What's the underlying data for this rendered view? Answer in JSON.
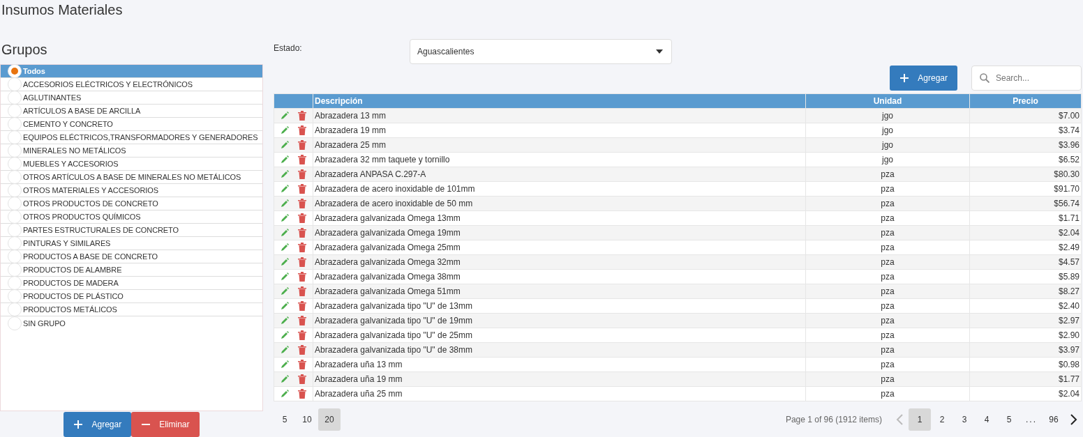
{
  "title": "Insumos Materiales",
  "groups": {
    "heading": "Grupos",
    "items": [
      {
        "label": "Todos",
        "selected": true
      },
      {
        "label": "ACCESORIOS ELÉCTRICOS Y ELECTRÓNICOS",
        "selected": false
      },
      {
        "label": "AGLUTINANTES",
        "selected": false
      },
      {
        "label": "ARTÍCULOS A BASE DE ARCILLA",
        "selected": false
      },
      {
        "label": "CEMENTO Y CONCRETO",
        "selected": false
      },
      {
        "label": "EQUIPOS ELÉCTRICOS,TRANSFORMADORES Y GENERADORES",
        "selected": false
      },
      {
        "label": "MINERALES NO METÁLICOS",
        "selected": false
      },
      {
        "label": "MUEBLES Y ACCESORIOS",
        "selected": false
      },
      {
        "label": "OTROS ARTÍCULOS A BASE DE MINERALES NO METÁLICOS",
        "selected": false
      },
      {
        "label": "OTROS MATERIALES Y ACCESORIOS",
        "selected": false
      },
      {
        "label": "OTROS PRODUCTOS DE CONCRETO",
        "selected": false
      },
      {
        "label": "OTROS PRODUCTOS QUÍMICOS",
        "selected": false
      },
      {
        "label": "PARTES ESTRUCTURALES DE CONCRETO",
        "selected": false
      },
      {
        "label": "PINTURAS Y SIMILARES",
        "selected": false
      },
      {
        "label": "PRODUCTOS A BASE DE CONCRETO",
        "selected": false
      },
      {
        "label": "PRODUCTOS DE ALAMBRE",
        "selected": false
      },
      {
        "label": "PRODUCTOS DE MADERA",
        "selected": false
      },
      {
        "label": "PRODUCTOS DE PLÁSTICO",
        "selected": false
      },
      {
        "label": "PRODUCTOS METÁLICOS",
        "selected": false
      },
      {
        "label": "SIN GRUPO",
        "selected": false
      }
    ],
    "buttons": [
      {
        "kind": "add",
        "label": "Agregar"
      },
      {
        "kind": "remove",
        "label": "Eliminar"
      }
    ]
  },
  "filter": {
    "label": "Estado:",
    "value": "Aguascalientes"
  },
  "toolbar": {
    "add_button": "Agregar",
    "search": {
      "placeholder": "Search..."
    }
  },
  "table": {
    "columns": [
      "Descripción",
      "Unidad",
      "Precio"
    ],
    "rows": [
      {
        "description": "Abrazadera 13 mm",
        "unit": "jgo",
        "price": "$7.00"
      },
      {
        "description": "Abrazadera 19 mm",
        "unit": "jgo",
        "price": "$3.74"
      },
      {
        "description": "Abrazadera 25 mm",
        "unit": "jgo",
        "price": "$3.96"
      },
      {
        "description": "Abrazadera 32 mm taquete y tornillo",
        "unit": "jgo",
        "price": "$6.52"
      },
      {
        "description": "Abrazadera ANPASA C.297-A",
        "unit": "pza",
        "price": "$80.30"
      },
      {
        "description": "Abrazadera de acero inoxidable de 101mm",
        "unit": "pza",
        "price": "$91.70"
      },
      {
        "description": "Abrazadera de acero inoxidable de 50 mm",
        "unit": "pza",
        "price": "$56.74"
      },
      {
        "description": "Abrazadera galvanizada Omega 13mm",
        "unit": "pza",
        "price": "$1.71"
      },
      {
        "description": "Abrazadera galvanizada Omega 19mm",
        "unit": "pza",
        "price": "$2.04"
      },
      {
        "description": "Abrazadera galvanizada Omega 25mm",
        "unit": "pza",
        "price": "$2.49"
      },
      {
        "description": "Abrazadera galvanizada Omega 32mm",
        "unit": "pza",
        "price": "$4.57"
      },
      {
        "description": "Abrazadera galvanizada Omega 38mm",
        "unit": "pza",
        "price": "$5.89"
      },
      {
        "description": "Abrazadera galvanizada Omega 51mm",
        "unit": "pza",
        "price": "$8.27"
      },
      {
        "description": "Abrazadera galvanizada tipo \"U\" de 13mm",
        "unit": "pza",
        "price": "$2.40"
      },
      {
        "description": "Abrazadera galvanizada tipo \"U\" de 19mm",
        "unit": "pza",
        "price": "$2.97"
      },
      {
        "description": "Abrazadera galvanizada tipo \"U\" de 25mm",
        "unit": "pza",
        "price": "$2.90"
      },
      {
        "description": "Abrazadera galvanizada tipo \"U\" de 38mm",
        "unit": "pza",
        "price": "$3.97"
      },
      {
        "description": "Abrazadera uña 13 mm",
        "unit": "pza",
        "price": "$0.98"
      },
      {
        "description": "Abrazadera uña 19 mm",
        "unit": "pza",
        "price": "$1.77"
      },
      {
        "description": "Abrazadera uña 25 mm",
        "unit": "pza",
        "price": "$2.04"
      }
    ]
  },
  "pager": {
    "page_sizes": [
      {
        "label": "5",
        "selected": false
      },
      {
        "label": "10",
        "selected": false
      },
      {
        "label": "20",
        "selected": true
      }
    ],
    "info": "Page 1 of 96 (1912 items)",
    "prev": {
      "disabled": true
    },
    "pages": [
      {
        "label": "1",
        "selected": true
      },
      {
        "label": "2",
        "selected": false
      },
      {
        "label": "3",
        "selected": false
      },
      {
        "label": "4",
        "selected": false
      },
      {
        "label": "5",
        "selected": false
      }
    ],
    "ellipsis": "...",
    "last": {
      "label": "96",
      "selected": false
    },
    "next": {
      "disabled": false
    }
  }
}
